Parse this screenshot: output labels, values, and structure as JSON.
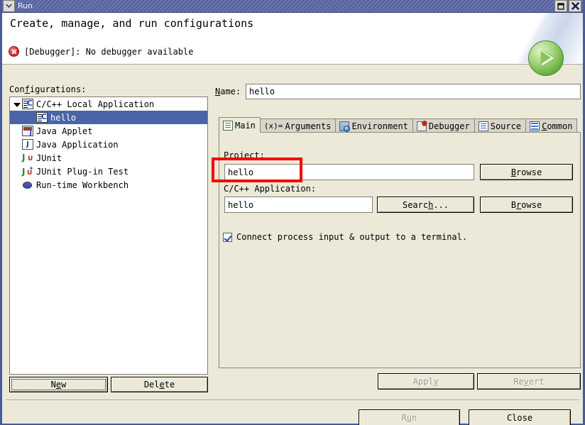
{
  "window": {
    "title": "Run",
    "menu_icon": "window-menu-chevron-icon",
    "maximize_icon": "maximize-icon",
    "close_icon": "close-icon"
  },
  "header": {
    "title": "Create, manage, and run configurations",
    "status_icon": "error-icon",
    "status_message": "[Debugger]: No debugger available",
    "banner_icon": "run-play-icon"
  },
  "sidebar": {
    "label": "Configurations:",
    "label_mnemonic": "f",
    "items": [
      {
        "label": "C/C++ Local Application",
        "icon": "cpp-application-icon",
        "indent": 0,
        "expanded": true,
        "selected": false
      },
      {
        "label": "hello",
        "icon": "cpp-config-icon",
        "indent": 1,
        "expanded": false,
        "selected": true
      },
      {
        "label": "Java Applet",
        "icon": "java-applet-icon",
        "indent": 0,
        "expanded": false,
        "selected": false
      },
      {
        "label": "Java Application",
        "icon": "java-application-icon",
        "indent": 0,
        "expanded": false,
        "selected": false
      },
      {
        "label": "JUnit",
        "icon": "junit-icon",
        "indent": 0,
        "expanded": false,
        "selected": false
      },
      {
        "label": "JUnit Plug-in Test",
        "icon": "junit-plugin-icon",
        "indent": 0,
        "expanded": false,
        "selected": false
      },
      {
        "label": "Run-time Workbench",
        "icon": "workbench-icon",
        "indent": 0,
        "expanded": false,
        "selected": false
      }
    ],
    "new_button": "New",
    "delete_button": "Delete"
  },
  "main": {
    "name_label": "Name:",
    "name_value": "hello",
    "tabs": [
      {
        "label": "Main",
        "icon": "document-icon",
        "active": true
      },
      {
        "label": "Arguments",
        "icon": "arguments-icon",
        "active": false,
        "prefix": "(x)="
      },
      {
        "label": "Environment",
        "icon": "environment-icon",
        "active": false
      },
      {
        "label": "Debugger",
        "icon": "debugger-icon",
        "active": false
      },
      {
        "label": "Source",
        "icon": "source-icon",
        "active": false
      },
      {
        "label": "Common",
        "icon": "common-icon",
        "active": false
      }
    ],
    "project_label": "Project:",
    "project_value": "hello",
    "project_browse": "Browse",
    "application_label": "C/C++ Application:",
    "application_value": "hello",
    "application_search": "Search...",
    "application_browse": "Browse",
    "terminal_checkbox_label": "Connect process input & output to a terminal.",
    "terminal_checkbox_checked": true
  },
  "footer": {
    "apply_button": "Apply",
    "apply_enabled": false,
    "revert_button": "Revert",
    "revert_enabled": false,
    "run_button": "Run",
    "run_enabled": false,
    "close_button": "Close",
    "close_enabled": true
  },
  "annotation": {
    "type": "highlight-rectangle",
    "color": "#f60000",
    "target": "project-field"
  },
  "colors": {
    "titlebar": "#55619f",
    "selection": "#4a64a8",
    "dialog_bg": "#ece9d8",
    "annotation": "#f60000",
    "error": "#e02b2b",
    "run_green": "#63ad3f"
  }
}
